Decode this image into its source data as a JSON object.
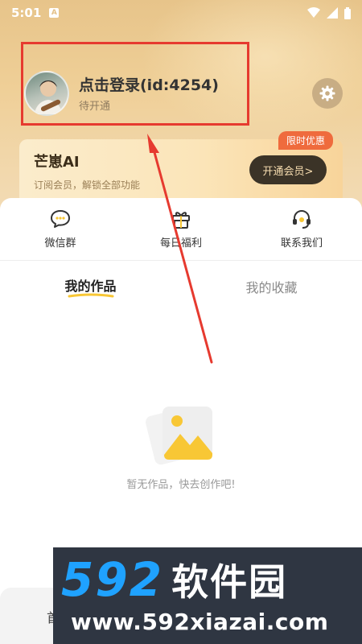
{
  "status_bar": {
    "time": "5:01",
    "notif_letter": "A",
    "icons": [
      "wifi-icon",
      "signal-icon",
      "battery-icon"
    ]
  },
  "profile": {
    "username": "点击登录(id:4254)",
    "status": "待开通"
  },
  "vip": {
    "title": "芒崽AI",
    "description": "订阅会员，解锁全部功能",
    "badge": "限时优惠",
    "button_label": "开通会员>"
  },
  "quick_actions": [
    {
      "label": "微信群",
      "icon": "chat-icon"
    },
    {
      "label": "每日福利",
      "icon": "gift-icon"
    },
    {
      "label": "联系我们",
      "icon": "headset-icon"
    }
  ],
  "tabs": [
    {
      "label": "我的作品",
      "active": true
    },
    {
      "label": "我的收藏",
      "active": false
    }
  ],
  "empty_state": {
    "message": "暂无作品，快去创作吧!",
    "icon": "image-placeholder-icon"
  },
  "bottom_nav": {
    "home_label_partial": "首"
  },
  "watermark": {
    "brand_number": "592",
    "brand_name": "软件园",
    "url": "www.592xiazai.com"
  },
  "colors": {
    "accent": "#f8c735",
    "highlight": "#e63a2f",
    "vip_button_bg": "#3b3327",
    "badge": "#ef6b3d"
  }
}
